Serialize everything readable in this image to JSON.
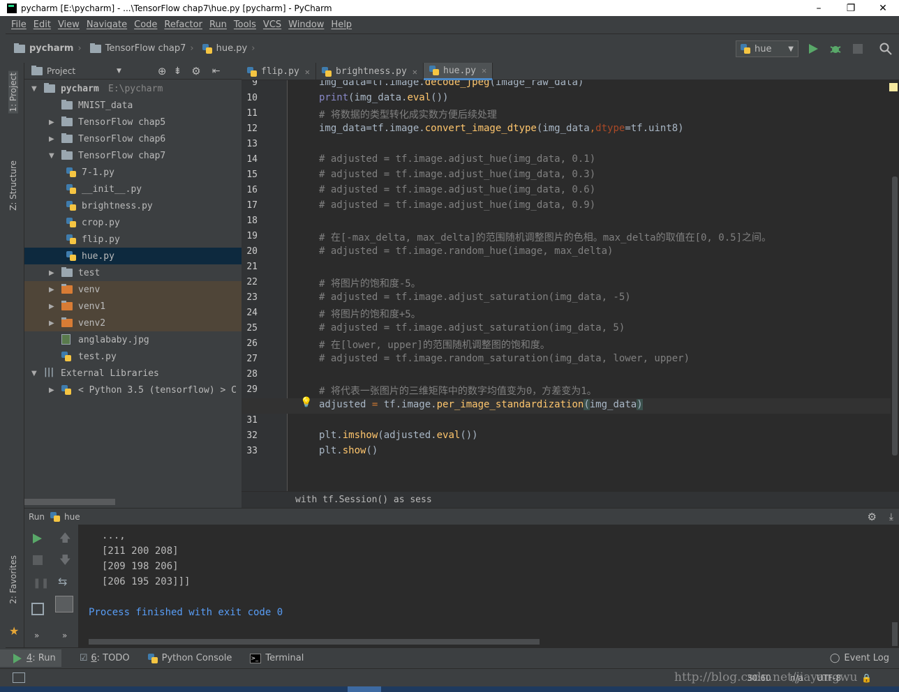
{
  "window": {
    "title": "pycharm [E:\\pycharm] - ...\\TensorFlow chap7\\hue.py [pycharm] - PyCharm",
    "min": "–",
    "max": "❐",
    "close": "✕"
  },
  "menu": [
    "File",
    "Edit",
    "View",
    "Navigate",
    "Code",
    "Refactor",
    "Run",
    "Tools",
    "VCS",
    "Window",
    "Help"
  ],
  "breadcrumbs": [
    "pycharm",
    "TensorFlow chap7",
    "hue.py"
  ],
  "run_config": "hue",
  "side_tabs": {
    "project": "1: Project",
    "structure": "Z: Structure",
    "favorites": "2: Favorites"
  },
  "project_panel": {
    "title": "Project"
  },
  "tree": [
    {
      "label": "pycharm",
      "extra": "E:\\pycharm",
      "indent": 0,
      "arrow": "▼",
      "icon": "folder",
      "bold": true
    },
    {
      "label": "MNIST_data",
      "indent": 1,
      "arrow": "",
      "icon": "folder"
    },
    {
      "label": "TensorFlow chap5",
      "indent": 1,
      "arrow": "▶",
      "icon": "folder"
    },
    {
      "label": "TensorFlow chap6",
      "indent": 1,
      "arrow": "▶",
      "icon": "folder"
    },
    {
      "label": "TensorFlow chap7",
      "indent": 1,
      "arrow": "▼",
      "icon": "folder"
    },
    {
      "label": "7-1.py",
      "indent": 2,
      "arrow": "",
      "icon": "py"
    },
    {
      "label": "__init__.py",
      "indent": 2,
      "arrow": "",
      "icon": "py"
    },
    {
      "label": "brightness.py",
      "indent": 2,
      "arrow": "",
      "icon": "py"
    },
    {
      "label": "crop.py",
      "indent": 2,
      "arrow": "",
      "icon": "py"
    },
    {
      "label": "flip.py",
      "indent": 2,
      "arrow": "",
      "icon": "py"
    },
    {
      "label": "hue.py",
      "indent": 2,
      "arrow": "",
      "icon": "py",
      "selected": true
    },
    {
      "label": "test",
      "indent": 1,
      "arrow": "▶",
      "icon": "folder"
    },
    {
      "label": "venv",
      "indent": 1,
      "arrow": "▶",
      "icon": "ofolder",
      "excluded": true
    },
    {
      "label": "venv1",
      "indent": 1,
      "arrow": "▶",
      "icon": "ofolder",
      "excluded": true
    },
    {
      "label": "venv2",
      "indent": 1,
      "arrow": "▶",
      "icon": "ofolder",
      "excluded": true
    },
    {
      "label": "anglababy.jpg",
      "indent": 1,
      "arrow": "",
      "icon": "img"
    },
    {
      "label": "test.py",
      "indent": 1,
      "arrow": "",
      "icon": "py"
    },
    {
      "label": "External Libraries",
      "indent": 0,
      "arrow": "▼",
      "icon": "lib"
    },
    {
      "label": "< Python 3.5 (tensorflow) > C",
      "indent": 1,
      "arrow": "▶",
      "icon": "py"
    }
  ],
  "tabs": [
    {
      "label": "flip.py",
      "active": false
    },
    {
      "label": "brightness.py",
      "active": false
    },
    {
      "label": "hue.py",
      "active": true
    }
  ],
  "code": [
    {
      "n": "9",
      "html": "img_data=tf.image.<span class=\"fn\">decode_jpeg</span>(image_raw_data)"
    },
    {
      "n": "10",
      "html": "<span class=\"bi\">print</span>(img_data.<span class=\"fn\">eval</span>())"
    },
    {
      "n": "11",
      "html": "<span class=\"cm\"># 将数据的类型转化成实数方便后续处理</span>"
    },
    {
      "n": "12",
      "html": "img_data=tf.image.<span class=\"fn\">convert_image_dtype</span>(img_data<span class=\"kw\">,</span><span style=\"color:#aa4926\">dtype</span>=tf.uint8)"
    },
    {
      "n": "13",
      "html": ""
    },
    {
      "n": "14",
      "html": "<span class=\"cm\"># adjusted = tf.image.adjust_hue(img_data, 0.1)</span>"
    },
    {
      "n": "15",
      "html": "<span class=\"cm\"># adjusted = tf.image.adjust_hue(img_data, 0.3)</span>"
    },
    {
      "n": "16",
      "html": "<span class=\"cm\"># adjusted = tf.image.adjust_hue(img_data, 0.6)</span>"
    },
    {
      "n": "17",
      "html": "<span class=\"cm\"># adjusted = tf.image.adjust_hue(img_data, 0.9)</span>"
    },
    {
      "n": "18",
      "html": ""
    },
    {
      "n": "19",
      "html": "<span class=\"cm\"># 在[-max_delta, max_delta]的范围随机调整图片的色相。max_delta的取值在[0, 0.5]之间。</span>"
    },
    {
      "n": "20",
      "html": "<span class=\"cm\"># adjusted = tf.image.random_hue(image, max_delta)</span>"
    },
    {
      "n": "21",
      "html": ""
    },
    {
      "n": "22",
      "html": "<span class=\"cm\"># 将图片的饱和度-5。</span>"
    },
    {
      "n": "23",
      "html": "<span class=\"cm\"># adjusted = tf.image.adjust_saturation(img_data, -5)</span>"
    },
    {
      "n": "24",
      "html": "<span class=\"cm\"># 将图片的饱和度+5。</span>"
    },
    {
      "n": "25",
      "html": "<span class=\"cm\"># adjusted = tf.image.adjust_saturation(img_data, 5)</span>"
    },
    {
      "n": "26",
      "html": "<span class=\"cm\"># 在[lower, upper]的范围随机调整图的饱和度。</span>"
    },
    {
      "n": "27",
      "html": "<span class=\"cm\"># adjusted = tf.image.random_saturation(img_data, lower, upper)</span>"
    },
    {
      "n": "28",
      "html": ""
    },
    {
      "n": "29",
      "html": "<span class=\"cm\"># 将代表一张图片的三维矩阵中的数字均值变为0，方差变为1。</span>"
    },
    {
      "n": "30",
      "html": "adjusted <span class=\"kw\">=</span> tf.image.<span class=\"fn\">per_image_standardization</span><span style=\"background:#3b514d\">(</span>img_data<span style=\"background:#3b514d\">)</span>",
      "current": true
    },
    {
      "n": "31",
      "html": ""
    },
    {
      "n": "32",
      "html": "plt.<span class=\"fn\">imshow</span>(adjusted.<span class=\"fn\">eval</span>())"
    },
    {
      "n": "33",
      "html": "plt.<span class=\"fn\">show</span>()"
    }
  ],
  "editor_breadcrumb": "with tf.Session() as sess",
  "run_panel": {
    "label": "Run",
    "config": "hue"
  },
  "console": [
    "...,",
    "[211 200 208]",
    "[209 198 206]",
    "[206 195 203]]]"
  ],
  "console_exit": "Process finished with exit code 0",
  "bottom_tabs": [
    {
      "num": "4",
      "label": ": Run"
    },
    {
      "num": "6",
      "label": ": TODO"
    },
    {
      "num": "",
      "label": "Python Console"
    },
    {
      "num": "",
      "label": "Terminal"
    }
  ],
  "event_log": "Event Log",
  "status": {
    "position": "30:60",
    "separator": "n/a",
    "encoding": "UTF-8",
    "watermark": "http://blog.csdn.net/jiayangwu"
  },
  "colors": {
    "accent": "#4a88c7",
    "editor_bg": "#2b2b2b",
    "panel_bg": "#3c3f41",
    "run_green": "#59a869"
  }
}
